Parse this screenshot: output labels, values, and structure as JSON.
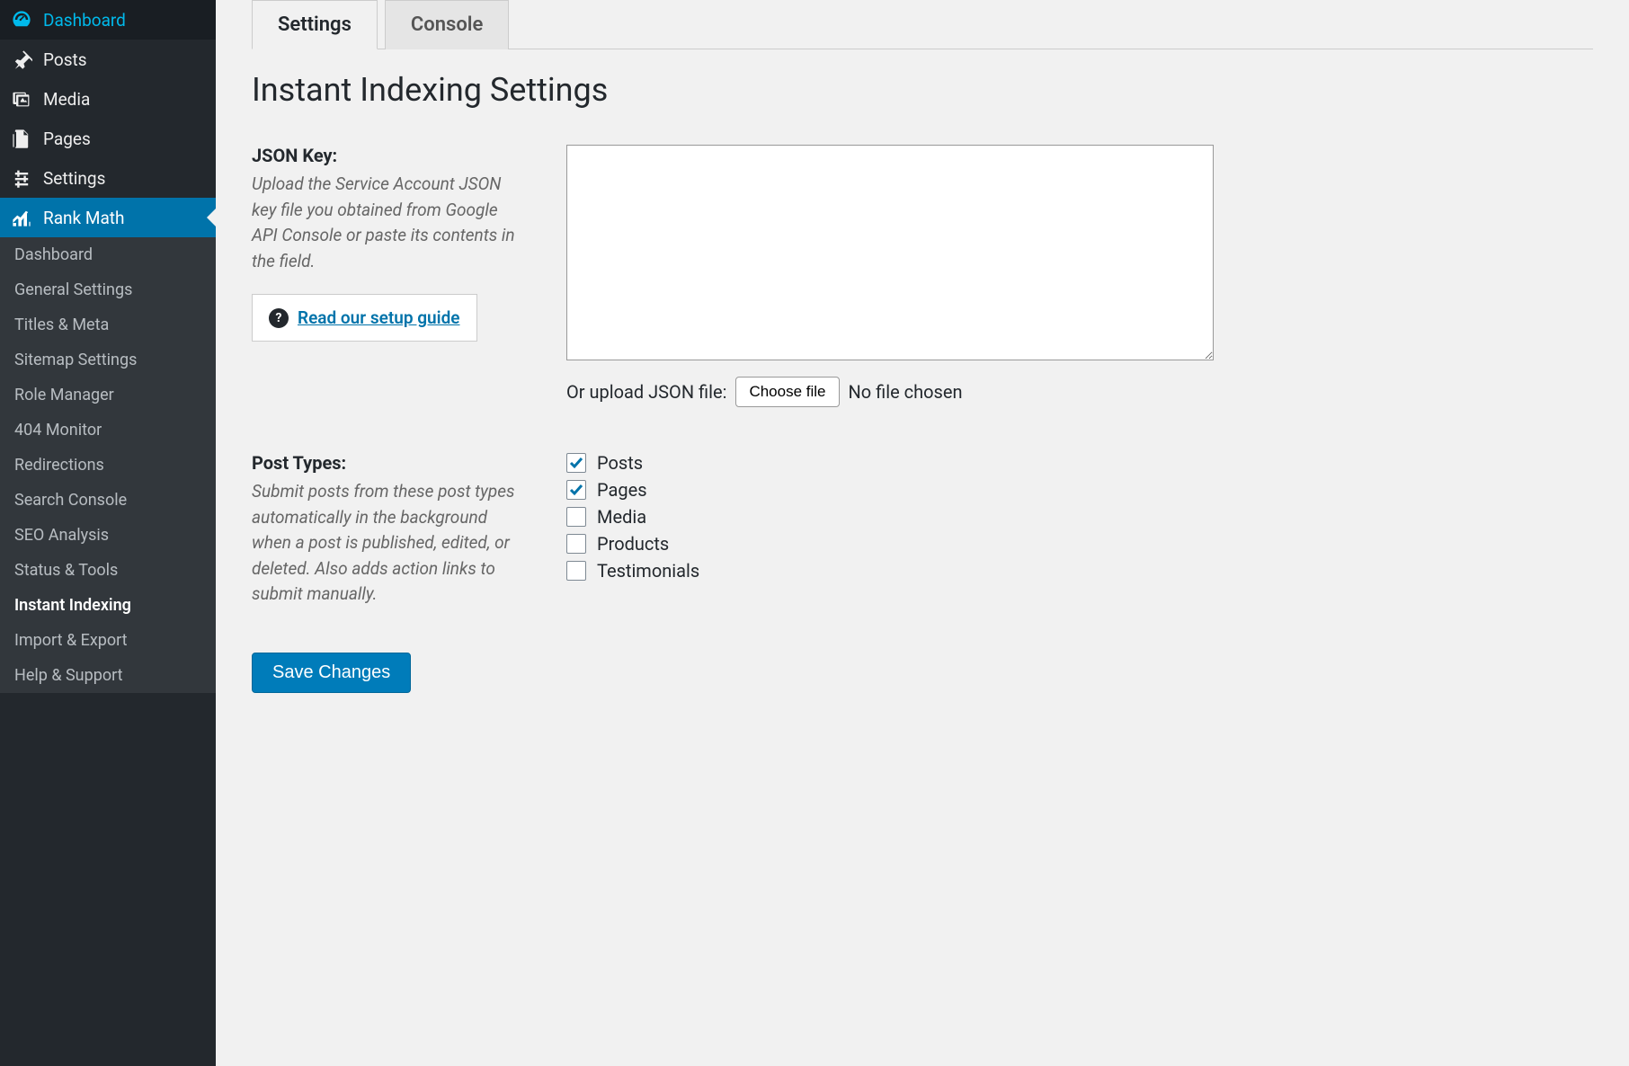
{
  "sidebar": {
    "items": [
      {
        "label": "Dashboard",
        "icon": "dashboard"
      },
      {
        "label": "Posts",
        "icon": "pin"
      },
      {
        "label": "Media",
        "icon": "media"
      },
      {
        "label": "Pages",
        "icon": "pages"
      },
      {
        "label": "Settings",
        "icon": "settings"
      },
      {
        "label": "Rank Math",
        "icon": "rankmath",
        "active": true
      }
    ],
    "submenu": [
      {
        "label": "Dashboard"
      },
      {
        "label": "General Settings"
      },
      {
        "label": "Titles & Meta"
      },
      {
        "label": "Sitemap Settings"
      },
      {
        "label": "Role Manager"
      },
      {
        "label": "404 Monitor"
      },
      {
        "label": "Redirections"
      },
      {
        "label": "Search Console"
      },
      {
        "label": "SEO Analysis"
      },
      {
        "label": "Status & Tools"
      },
      {
        "label": "Instant Indexing",
        "current": true
      },
      {
        "label": "Import & Export"
      },
      {
        "label": "Help & Support"
      }
    ]
  },
  "tabs": [
    {
      "label": "Settings",
      "active": true
    },
    {
      "label": "Console"
    }
  ],
  "page_title": "Instant Indexing Settings",
  "json_key": {
    "label": "JSON Key:",
    "desc": "Upload the Service Account JSON key file you obtained from Google API Console or paste its contents in the field.",
    "setup_guide": "Read our setup guide",
    "upload_label": "Or upload JSON file:",
    "choose_file": "Choose file",
    "no_file": "No file chosen",
    "value": ""
  },
  "post_types": {
    "label": "Post Types:",
    "desc": "Submit posts from these post types automatically in the background when a post is published, edited, or deleted. Also adds action links to submit manually.",
    "options": [
      {
        "label": "Posts",
        "checked": true
      },
      {
        "label": "Pages",
        "checked": true
      },
      {
        "label": "Media",
        "checked": false
      },
      {
        "label": "Products",
        "checked": false
      },
      {
        "label": "Testimonials",
        "checked": false
      }
    ]
  },
  "save_button": "Save Changes"
}
